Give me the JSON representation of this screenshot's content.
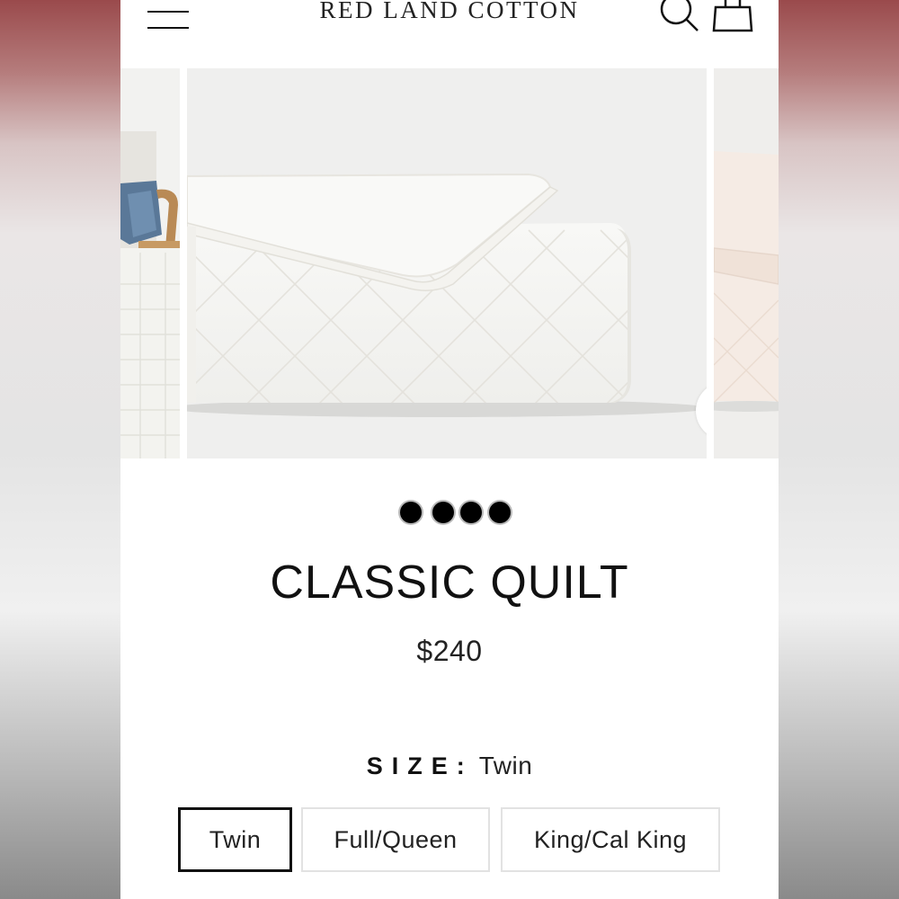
{
  "header": {
    "brand": "RED LAND COTTON",
    "menu_icon": "hamburger-menu-icon",
    "search_icon": "search-icon",
    "cart_icon": "shopping-bag-icon"
  },
  "gallery": {
    "zoom_icon": "zoom-icon",
    "dot_count": 4
  },
  "product": {
    "title": "CLASSIC QUILT",
    "price": "$240",
    "size_label": "SIZE:",
    "size_value": "Twin",
    "options": [
      {
        "label": "Twin",
        "selected": true
      },
      {
        "label": "Full/Queen",
        "selected": false
      },
      {
        "label": "King/Cal King",
        "selected": false
      }
    ]
  },
  "colors": {
    "text": "#111111",
    "border": "#e2e2e2",
    "background": "#ffffff"
  }
}
